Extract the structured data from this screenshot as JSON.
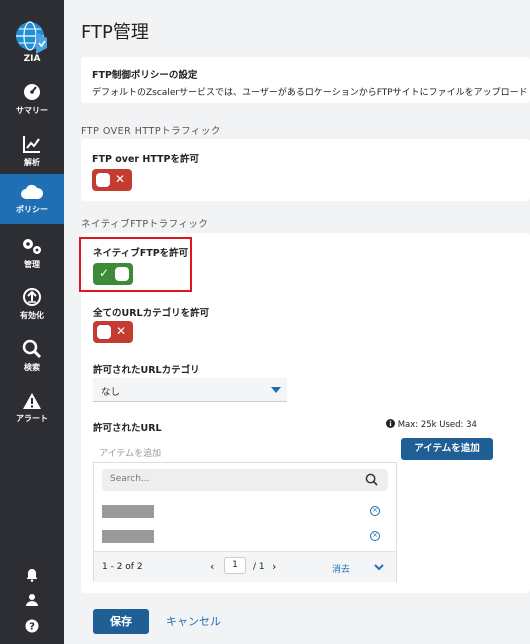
{
  "app": {
    "logo_text": "ZIA"
  },
  "sidebar": {
    "items": [
      {
        "label": "サマリー",
        "icon": "gauge-icon"
      },
      {
        "label": "解析",
        "icon": "chart-icon"
      },
      {
        "label": "ポリシー",
        "icon": "cloud-icon",
        "active": true
      },
      {
        "label": "管理",
        "icon": "gears-icon"
      },
      {
        "label": "有効化",
        "icon": "upload-icon"
      },
      {
        "label": "検索",
        "icon": "search-icon"
      },
      {
        "label": "アラート",
        "icon": "warning-icon"
      }
    ],
    "bottom_icons": [
      "bell-icon",
      "user-icon",
      "help-icon"
    ]
  },
  "page": {
    "title": "FTP管理",
    "policy_heading": "FTP制御ポリシーの設定",
    "policy_desc": "デフォルトのZscalerサービスでは、ユーザーがあるロケーションからFTPサイトにファイルをアップロード",
    "section_http": "FTP OVER HTTPトラフィック",
    "ftp_over_http_label": "FTP over HTTPを許可",
    "ftp_over_http_state": "off",
    "section_native": "ネイティブFTPトラフィック",
    "native_ftp_label": "ネイティブFTPを許可",
    "native_ftp_state": "on",
    "all_url_label": "全てのURLカテゴリを許可",
    "all_url_state": "off",
    "allowed_cat_label": "許可されたURLカテゴリ",
    "allowed_cat_value": "なし",
    "allowed_url_label": "許可されたURL",
    "url_info": "Max: 25k  Used: 34",
    "url_placeholder": "アイテムを追加",
    "add_item_button": "アイテムを追加",
    "search_placeholder": "Search...",
    "pager_range": "1 - 2 of 2",
    "pager_page": "1",
    "pager_total": "/ 1",
    "clear_label": "消去",
    "save_label": "保存",
    "cancel_label": "キャンセル"
  },
  "colors": {
    "accent": "#1f6fb5",
    "toggle_off": "#c43b2f",
    "toggle_on": "#3d8a37",
    "sidebar": "#2d2e33"
  }
}
